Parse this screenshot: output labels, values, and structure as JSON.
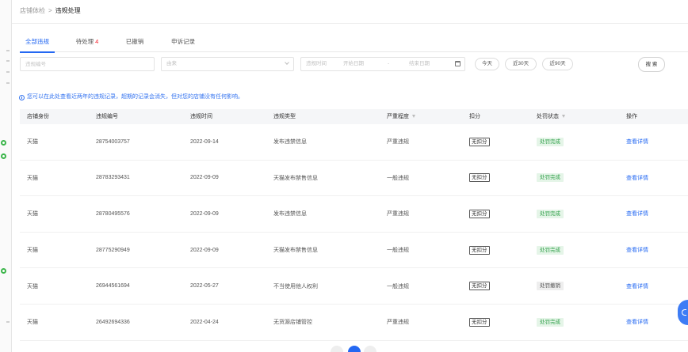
{
  "breadcrumb": {
    "parent": "店铺体检",
    "separator": ">",
    "current": "违规处理"
  },
  "tabs": [
    {
      "label": "全部违规",
      "active": true
    },
    {
      "label": "待处理",
      "count": "4",
      "active": false
    },
    {
      "label": "已撤销",
      "active": false
    },
    {
      "label": "申诉记录",
      "active": false
    }
  ],
  "filters": {
    "violation_id_placeholder": "违规编号",
    "source_placeholder": "由来",
    "date_label": "违规时间",
    "start_placeholder": "开始日期",
    "range_separator": "-",
    "end_placeholder": "结束日期",
    "quick_ranges": [
      "今天",
      "近30天",
      "近90天"
    ],
    "search_label": "搜 索"
  },
  "notice": "您可以在此处查看近两年的违规记录，超期的记录会消失，但对您的店铺没有任何影响。",
  "table": {
    "headers": {
      "shop": "店铺身份",
      "id": "违规编号",
      "time": "违规时间",
      "type": "违规类型",
      "severity": "严重程度",
      "points": "扣分",
      "status": "处罚状态",
      "action": "操作"
    },
    "rows": [
      {
        "shop": "天猫",
        "id": "28754003757",
        "time": "2022-09-14",
        "type": "发布违禁信息",
        "severity": "严重违规",
        "points": "无扣分",
        "status": "处罚完成",
        "status_color": "#31a04a",
        "status_bg": "#e5f5e8",
        "action": "查看详情"
      },
      {
        "shop": "天猫",
        "id": "28783293431",
        "time": "2022-09-09",
        "type": "天猫发布禁售信息",
        "severity": "一般违规",
        "points": "无扣分",
        "status": "处罚完成",
        "status_color": "#31a04a",
        "status_bg": "#e5f5e8",
        "action": "查看详情"
      },
      {
        "shop": "天猫",
        "id": "28780495576",
        "time": "2022-09-09",
        "type": "发布违禁信息",
        "severity": "严重违规",
        "points": "无扣分",
        "status": "处罚完成",
        "status_color": "#31a04a",
        "status_bg": "#e5f5e8",
        "action": "查看详情"
      },
      {
        "shop": "天猫",
        "id": "28775290949",
        "time": "2022-09-09",
        "type": "天猫发布禁售信息",
        "severity": "一般违规",
        "points": "无扣分",
        "status": "处罚完成",
        "status_color": "#31a04a",
        "status_bg": "#e5f5e8",
        "action": "查看详情"
      },
      {
        "shop": "天猫",
        "id": "26944561694",
        "time": "2022-05-27",
        "type": "不当使用他人权利",
        "severity": "一般违规",
        "points": "无扣分",
        "status": "处罚撤销",
        "status_color": "#555555",
        "status_bg": "#eeeeee",
        "action": "查看详情"
      },
      {
        "shop": "天猫",
        "id": "26492694336",
        "time": "2022-04-24",
        "type": "无货源店铺管控",
        "severity": "严重违规",
        "points": "无扣分",
        "status": "处罚完成",
        "status_color": "#31a04a",
        "status_bg": "#e5f5e8",
        "action": "查看详情"
      }
    ]
  },
  "icons": {
    "select": "chevron-down-icon",
    "date": "calendar-icon",
    "column_filter": "filter-icon",
    "notice": "info-icon",
    "help": "help-icon"
  },
  "colors": {
    "accent": "#2468f2",
    "danger": "#f5222d",
    "notice": "#3574f0",
    "sidebar_status": "#3bb54a"
  }
}
